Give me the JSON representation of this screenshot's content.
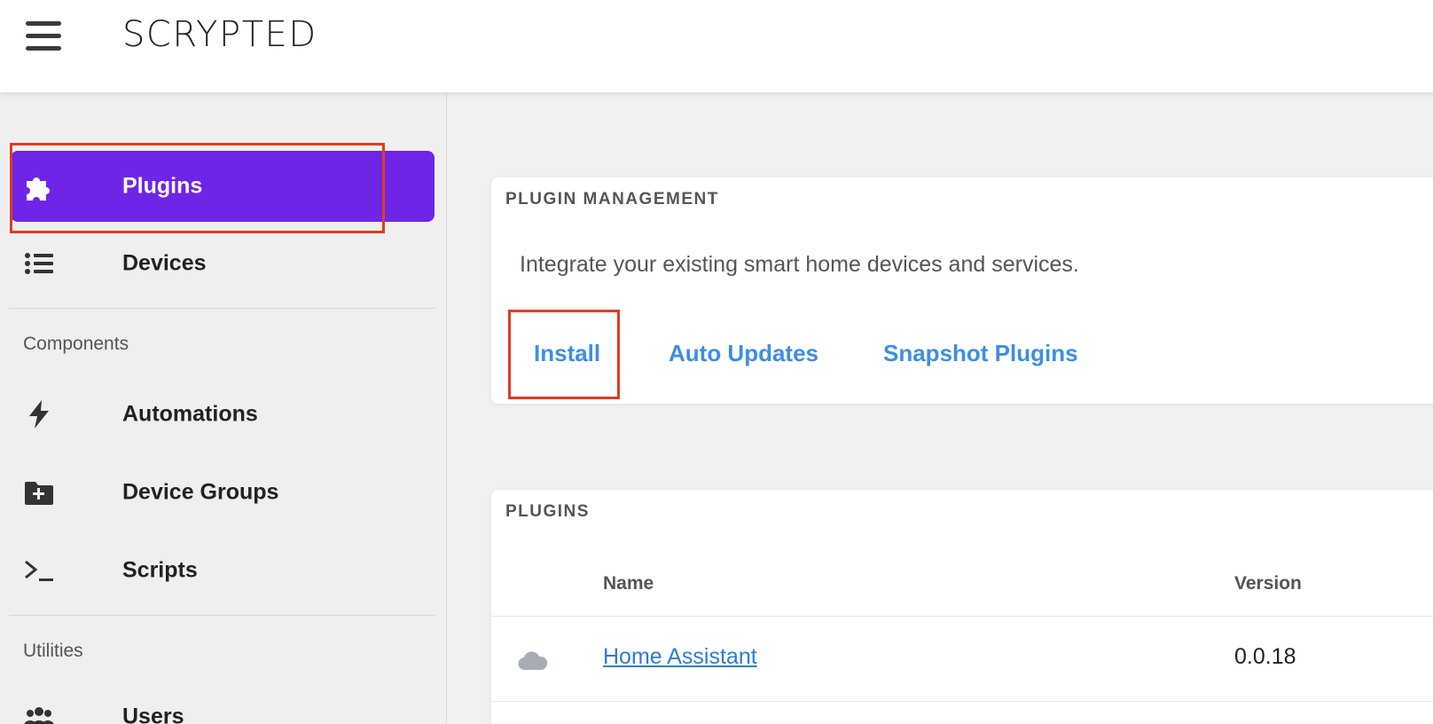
{
  "header": {
    "menu_icon": "hamburger-menu-icon",
    "brand": "SCRYPTED"
  },
  "sidebar": {
    "primary": [
      {
        "label": "Plugins",
        "icon": "puzzle-icon",
        "active": true
      },
      {
        "label": "Devices",
        "icon": "list-icon",
        "active": false
      }
    ],
    "sections": [
      {
        "title": "Components",
        "items": [
          {
            "label": "Automations",
            "icon": "bolt-icon"
          },
          {
            "label": "Device Groups",
            "icon": "folder-plus-icon"
          },
          {
            "label": "Scripts",
            "icon": "terminal-icon"
          }
        ]
      },
      {
        "title": "Utilities",
        "items": [
          {
            "label": "Users",
            "icon": "users-icon"
          }
        ]
      }
    ]
  },
  "plugin_management": {
    "title": "PLUGIN MANAGEMENT",
    "description": "Integrate your existing smart home devices and services.",
    "actions": [
      "Install",
      "Auto Updates",
      "Snapshot Plugins"
    ]
  },
  "plugins": {
    "title": "PLUGINS",
    "columns": [
      "Name",
      "Version"
    ],
    "rows": [
      {
        "icon": "cloud-icon",
        "name": "Home Assistant",
        "version": "0.0.18"
      }
    ]
  },
  "colors": {
    "accent": "#6f25e6",
    "link": "#3d8ee6",
    "highlight": "#e23b1f"
  }
}
